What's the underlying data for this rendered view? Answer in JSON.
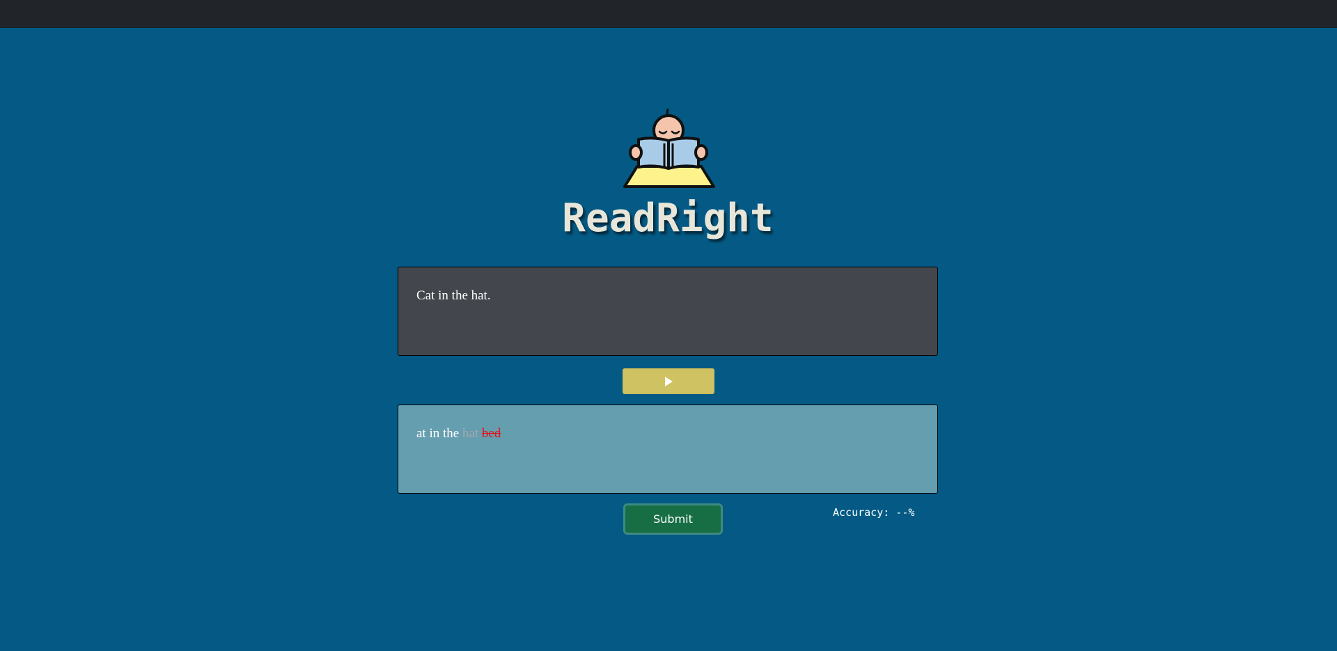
{
  "app": {
    "title": "ReadRight"
  },
  "logo": {
    "icon": "child-reading-book-icon"
  },
  "prompt": {
    "text": "Cat in the hat."
  },
  "play_button": {
    "icon": "play-icon"
  },
  "transcript": {
    "words": [
      {
        "text": "at",
        "status": "correct"
      },
      {
        "text": "in",
        "status": "correct"
      },
      {
        "text": "the",
        "status": "correct"
      },
      {
        "text": "hat",
        "status": "pending"
      },
      {
        "text": "bed",
        "status": "incorrect"
      }
    ],
    "w0": "at",
    "w1": "in",
    "w2": "the",
    "w3": "hat",
    "w4": "bed"
  },
  "submit": {
    "label": "Submit"
  },
  "accuracy": {
    "text": "Accuracy: --%"
  },
  "colors": {
    "background": "#045a85",
    "topbar": "#212529",
    "prompt_panel": "#43464c",
    "response_panel": "#659eaf",
    "play_button": "#cfc263",
    "submit_button": "#176e45",
    "incorrect_word": "#e0151c",
    "pending_word": "#a3a8ad"
  }
}
